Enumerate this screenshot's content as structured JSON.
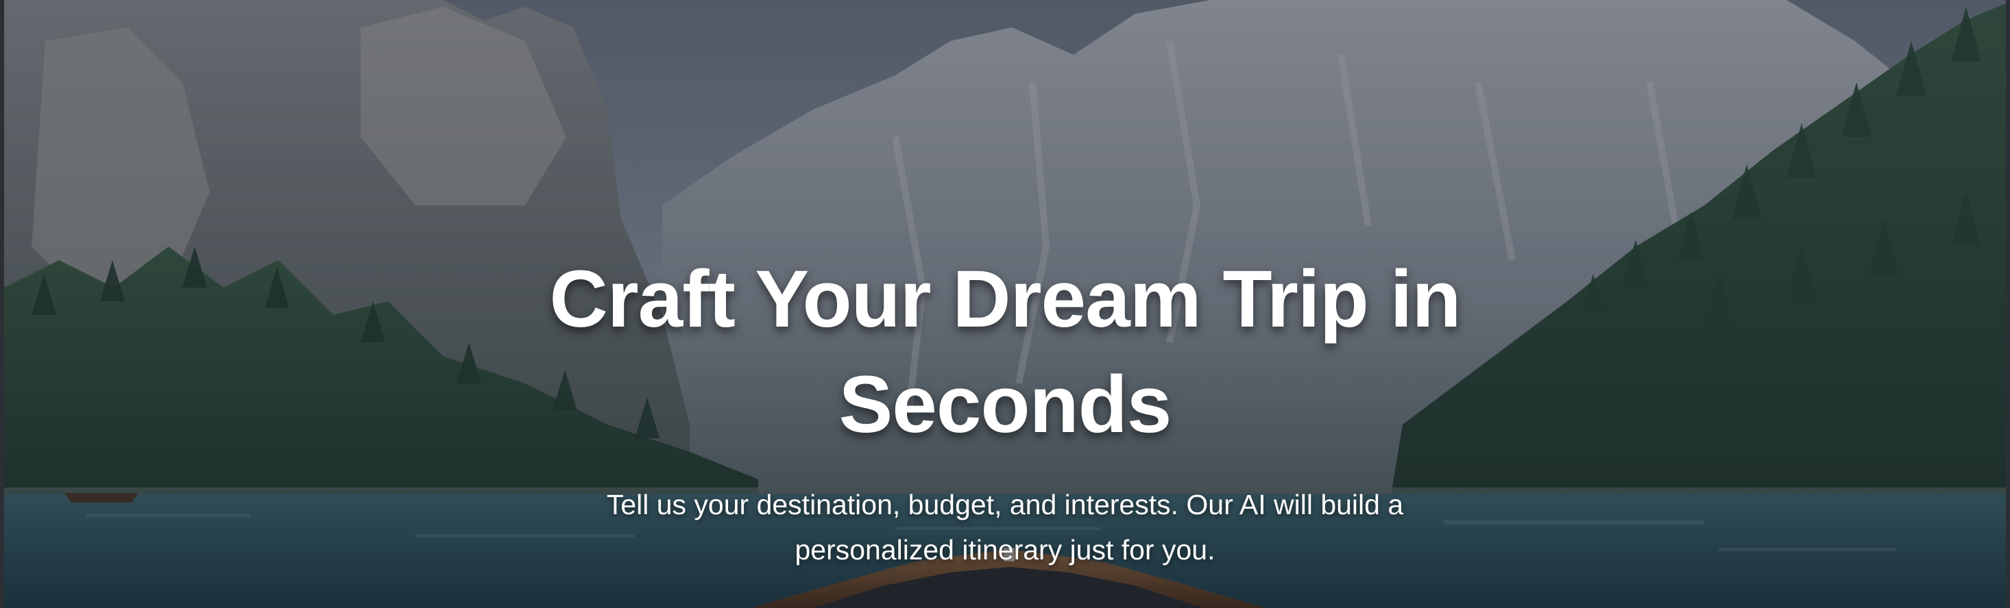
{
  "hero": {
    "title": "Craft Your Dream Trip in Seconds",
    "subtitle": "Tell us your destination, budget, and interests. Our AI will build a personalized itinerary just for you.",
    "background_image": "mountain-lake-boat-image"
  },
  "colors": {
    "overlay": "#121824",
    "text": "#ffffff",
    "water": "#2f5560",
    "forest": "#2f4a3c",
    "boat": "#6b4a2e"
  }
}
